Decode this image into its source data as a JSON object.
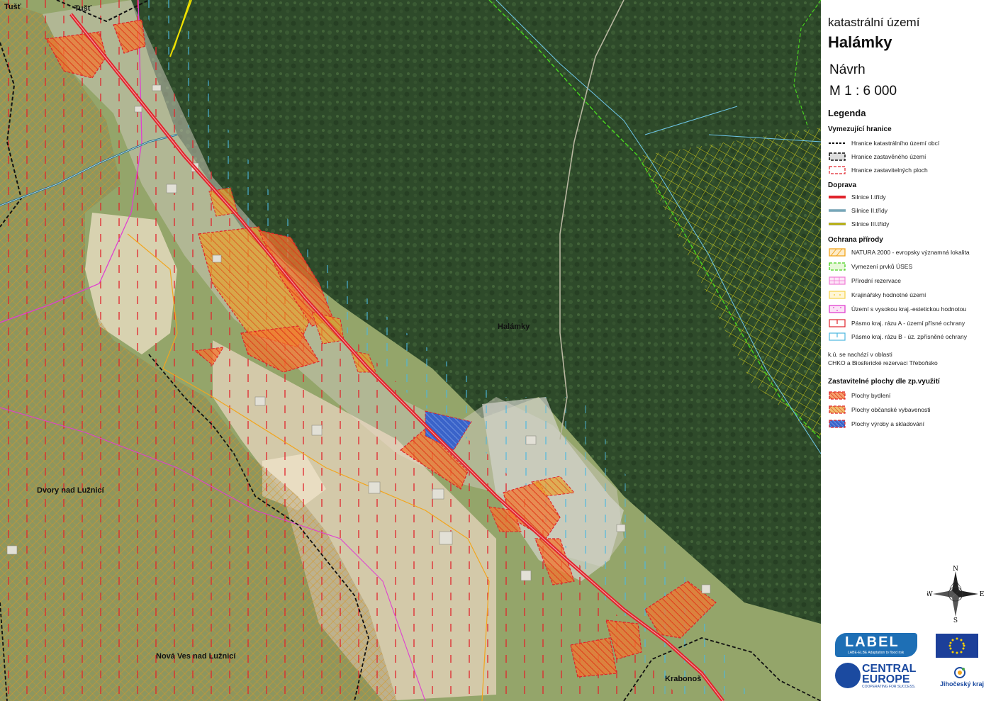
{
  "map": {
    "places": [
      {
        "name": "Tušť"
      },
      {
        "name": "Tušť"
      },
      {
        "name": "Halámky"
      },
      {
        "name": "Dvory nad Lužnicí"
      },
      {
        "name": "Nová Ves nad Lužnicí"
      },
      {
        "name": "Krabonoš"
      }
    ]
  },
  "panel": {
    "title1": "katastrální území",
    "title2": "Halámky",
    "status": "Návrh",
    "scale": "M 1 : 6 000",
    "legend_title": "Legenda",
    "sections": [
      {
        "title": "Vymezující hranice",
        "items": [
          {
            "label": "Hranice katastrálního území obcí",
            "symbol": "cadastral-boundary"
          },
          {
            "label": "Hranice zastavěného území",
            "symbol": "built-area-boundary"
          },
          {
            "label": "Hranice zastavitelných ploch",
            "symbol": "developable-boundary"
          }
        ]
      },
      {
        "title": "Doprava",
        "items": [
          {
            "label": "Silnice I.třídy",
            "symbol": "road-class-1",
            "color": "#e0232b"
          },
          {
            "label": "Silnice II.třídy",
            "symbol": "road-class-2",
            "color": "#6aa6c8"
          },
          {
            "label": "Silnice III.třídy",
            "symbol": "road-class-3",
            "color": "#d8d419"
          }
        ]
      },
      {
        "title": "Ochrana přírody",
        "items": [
          {
            "label": "NATURA 2000 - evropsky významná lokalita",
            "symbol": "natura-2000",
            "color": "#f2a51e"
          },
          {
            "label": "Vymezení prvků ÚSES",
            "symbol": "uses",
            "color": "#47d11f"
          },
          {
            "label": "Přírodní rezervace",
            "symbol": "nature-reserve",
            "color": "#f07cd6"
          },
          {
            "label": "Krajinářsky hodnotné území",
            "symbol": "landscape-value",
            "color": "#f5d24a"
          },
          {
            "label": "Území s vysokou kraj.-estetickou hodnotou",
            "symbol": "aesthetic-value",
            "color": "#e040d0"
          },
          {
            "label": "Pásmo kraj. rázu A - území přísné ochrany",
            "symbol": "zone-a",
            "color": "#e0232b"
          },
          {
            "label": "Pásmo kraj. rázu B - úz. zpřísněné ochrany",
            "symbol": "zone-b",
            "color": "#4cb7e0"
          }
        ]
      }
    ],
    "note_line1": "k.ú. se nachází v oblasti",
    "note_line2": "CHKO a Biosferické rezervaci Třeboňsko",
    "zones": {
      "title": "Zastavitelné plochy dle zp.využití",
      "items": [
        {
          "label": "Plochy bydlení",
          "symbol": "housing",
          "color": "#f26a2b"
        },
        {
          "label": "Plochy občanské vybavenosti",
          "symbol": "civic",
          "color": "#f2a51e"
        },
        {
          "label": "Plochy výroby a skladování",
          "symbol": "production",
          "color": "#3a63c9"
        }
      ]
    },
    "compass": {
      "n": "N",
      "s": "S",
      "e": "E",
      "w": "W"
    },
    "logos": {
      "label_big": "LABEL",
      "label_small": "LABE-ELBE Adaptation to flood risk",
      "ce_1": "CENTRAL",
      "ce_2": "EUROPE",
      "ce_3": "COOPERATING FOR SUCCESS.",
      "jk": "Jihočeský kraj"
    }
  }
}
